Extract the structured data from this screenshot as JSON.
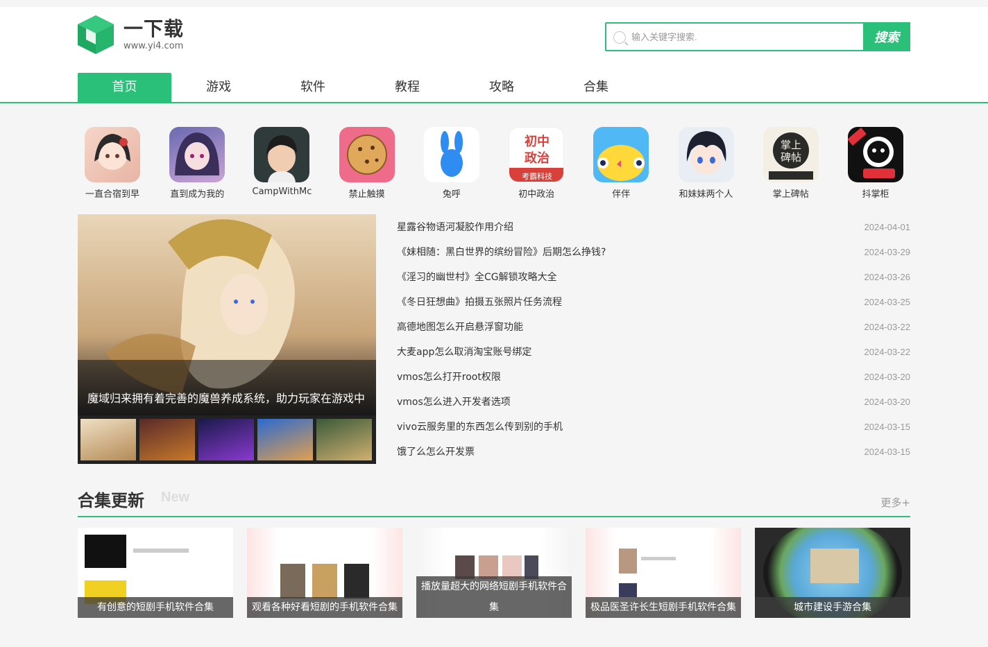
{
  "site": {
    "logo_title": "一下载",
    "logo_url": "www.yi4.com"
  },
  "search": {
    "placeholder": "输入关键字搜索.",
    "button": "搜索"
  },
  "nav": [
    "首页",
    "游戏",
    "软件",
    "教程",
    "攻略",
    "合集"
  ],
  "apps": [
    {
      "name": "一直合宿到早",
      "icon": "anime-girl-icon"
    },
    {
      "name": "直到成为我的",
      "icon": "anime-girl-icon"
    },
    {
      "name": "CampWithMc",
      "icon": "cartoon-man-icon"
    },
    {
      "name": "禁止触摸",
      "icon": "cookie-icon"
    },
    {
      "name": "兔呼",
      "icon": "rabbit-icon"
    },
    {
      "name": "初中政治",
      "icon": "textbook-icon"
    },
    {
      "name": "伴伴",
      "icon": "chick-icon"
    },
    {
      "name": "和妹妹两个人",
      "icon": "anime-boy-icon"
    },
    {
      "name": "掌上碑帖",
      "icon": "calligraphy-icon"
    },
    {
      "name": "抖掌柜",
      "icon": "mascot-icon"
    }
  ],
  "banner": {
    "caption": "魔域归来拥有着完善的魔兽养成系统，助力玩家在游戏中"
  },
  "news": [
    {
      "title": "星露谷物语河凝胶作用介绍",
      "date": "2024-04-01"
    },
    {
      "title": "《妹相随：黑白世界的缤纷冒险》后期怎么挣钱?",
      "date": "2024-03-29"
    },
    {
      "title": "《淫习的幽世村》全CG解锁攻略大全",
      "date": "2024-03-26"
    },
    {
      "title": "《冬日狂想曲》拍摄五张照片任务流程",
      "date": "2024-03-25"
    },
    {
      "title": "高德地图怎么开启悬浮窗功能",
      "date": "2024-03-22"
    },
    {
      "title": "大麦app怎么取消淘宝账号绑定",
      "date": "2024-03-22"
    },
    {
      "title": "vmos怎么打开root权限",
      "date": "2024-03-20"
    },
    {
      "title": "vmos怎么进入开发者选项",
      "date": "2024-03-20"
    },
    {
      "title": "vivo云服务里的东西怎么传到别的手机",
      "date": "2024-03-15"
    },
    {
      "title": "饿了么怎么开发票",
      "date": "2024-03-15"
    }
  ],
  "section": {
    "title": "合集更新",
    "sub": "New",
    "more": "更多+"
  },
  "collections": [
    {
      "label": "有创意的短剧手机软件合集"
    },
    {
      "label": "观看各种好看短剧的手机软件合集"
    },
    {
      "label": "播放量超大的网络短剧手机软件合集"
    },
    {
      "label": "极品医圣许长生短剧手机软件合集"
    },
    {
      "label": "城市建设手游合集"
    }
  ],
  "colors": {
    "accent": "#2bc07a"
  }
}
